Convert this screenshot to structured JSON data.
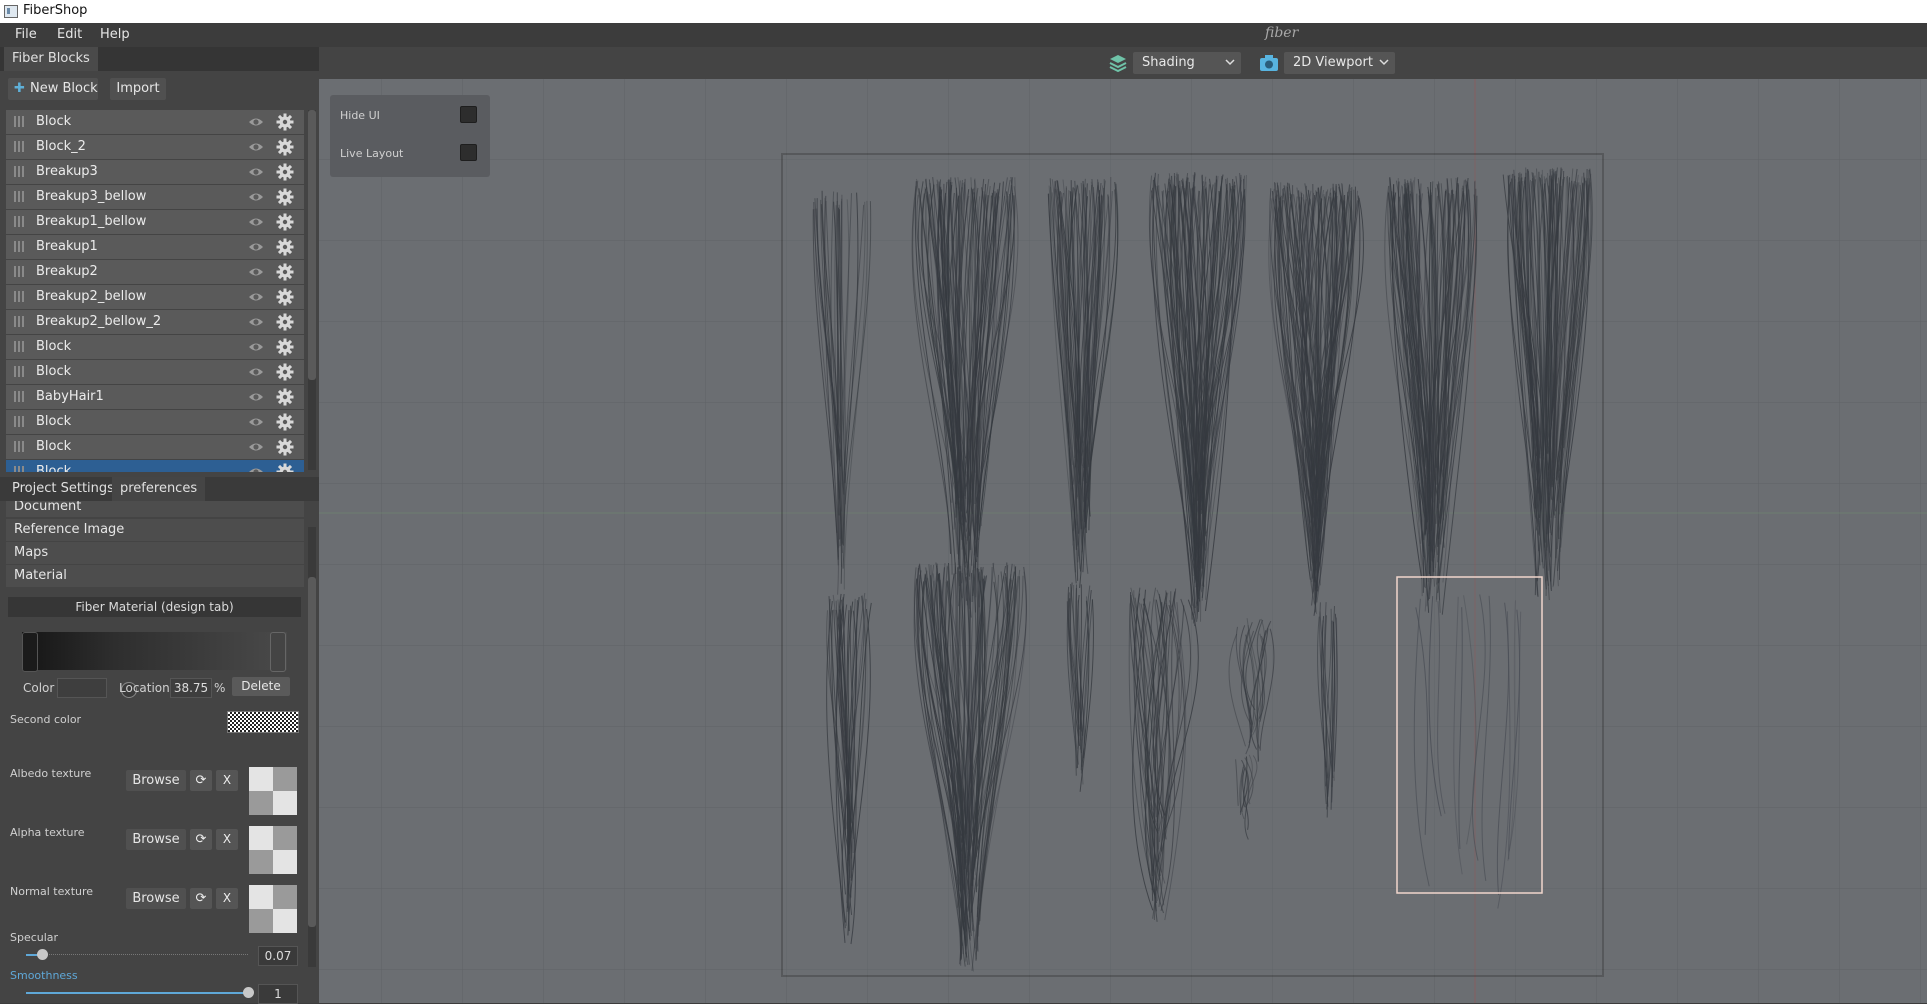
{
  "window": {
    "title": "FiberShop"
  },
  "menu": {
    "items": [
      "File",
      "Edit",
      "Help"
    ],
    "brand": "fiber"
  },
  "left_panel": {
    "tab": "Fiber Blocks",
    "new_block_label": "New Block",
    "import_label": "Import",
    "blocks": [
      "Block",
      "Block_2",
      "Breakup3",
      "Breakup3_bellow",
      "Breakup1_bellow",
      "Breakup1",
      "Breakup2",
      "Breakup2_bellow",
      "Breakup2_bellow_2",
      "Block",
      "Block",
      "BabyHair1",
      "Block",
      "Block",
      "Block"
    ],
    "selected_index": 14
  },
  "settings": {
    "tabs": [
      "Project Settings",
      "preferences"
    ],
    "sections": [
      "Document",
      "Reference Image",
      "Maps",
      "Material"
    ],
    "material_header": "Fiber Material (design tab)",
    "gradient": {
      "color_label": "Color",
      "location_label": "Location",
      "location_value": "38.75",
      "percent": "%",
      "delete_label": "Delete"
    },
    "second_color_label": "Second color",
    "textures": [
      {
        "label": "Albedo texture",
        "browse": "Browse",
        "reload_icon": "refresh-icon",
        "clear": "X"
      },
      {
        "label": "Alpha texture",
        "browse": "Browse",
        "reload_icon": "refresh-icon",
        "clear": "X"
      },
      {
        "label": "Normal texture",
        "browse": "Browse",
        "reload_icon": "refresh-icon",
        "clear": "X"
      }
    ],
    "specular": {
      "label": "Specular",
      "value": "0.07",
      "fraction": 0.07
    },
    "smoothness": {
      "label": "Smoothness",
      "value": "1",
      "fraction": 1.0
    }
  },
  "viewport_toolbar": {
    "shading_icon": "layers-icon",
    "shading_value": "Shading",
    "camera_icon": "camera-icon",
    "view_value": "2D Viewport"
  },
  "overlay": {
    "hide_ui_label": "Hide UI",
    "live_layout_label": "Live Layout"
  },
  "colors": {
    "accent": "#2d5f93",
    "viewport_bg": "#6b6e72",
    "selection_frame": "#f1d6cc",
    "smoothness_label": "#5fa8d8"
  }
}
